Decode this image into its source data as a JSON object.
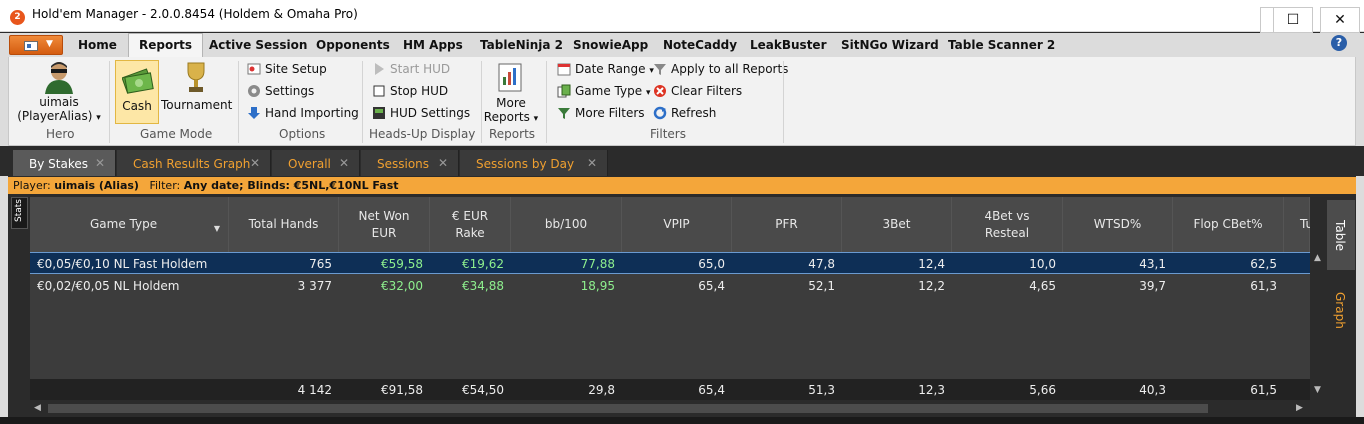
{
  "window": {
    "title": "Hold'em Manager - 2.0.0.8454 (Holdem & Omaha Pro)",
    "app_icon_text": "2",
    "minimize": "—",
    "maximize": "☐",
    "close": "✕"
  },
  "menu_tabs": [
    "Home",
    "Reports",
    "Active Session",
    "Opponents",
    "HM Apps",
    "TableNinja 2",
    "SnowieApp",
    "NoteCaddy",
    "LeakBuster",
    "SitNGo Wizard",
    "Table Scanner 2"
  ],
  "active_menu_tab": "Reports",
  "help_icon": "?",
  "ribbon": {
    "hero": {
      "player_line1": "uimais",
      "player_line2": "(PlayerAlias)",
      "dropdown": "▾",
      "group_label": "Hero"
    },
    "game_mode": {
      "cash_label": "Cash",
      "tournament_label": "Tournament",
      "group_label": "Game Mode"
    },
    "options": {
      "site_setup": "Site Setup",
      "settings": "Settings",
      "hand_importing": "Hand Importing",
      "group_label": "Options"
    },
    "hud": {
      "start_hud": "Start HUD",
      "stop_hud": "Stop HUD",
      "hud_settings": "HUD Settings",
      "group_label": "Heads-Up Display"
    },
    "reports": {
      "more_line1": "More",
      "more_line2": "Reports",
      "dropdown": "▾",
      "group_label": "Reports"
    },
    "filters": {
      "date_range": "Date Range",
      "game_type": "Game Type",
      "more_filters": "More Filters",
      "apply_all": "Apply to all Reports",
      "clear_filters": "Clear Filters",
      "refresh": "Refresh",
      "dropdown": "▾",
      "group_label": "Filters"
    }
  },
  "report_tabs": [
    {
      "label": "By Stakes",
      "active": true
    },
    {
      "label": "Cash Results Graph",
      "active": false
    },
    {
      "label": "Overall",
      "active": false
    },
    {
      "label": "Sessions",
      "active": false
    },
    {
      "label": "Sessions by Day",
      "active": false
    }
  ],
  "tab_close": "✕",
  "filter_bar": {
    "player_label": "Player:",
    "player_value": "uimais (Alias)",
    "filter_label": "Filter:",
    "filter_value": "Any date; Blinds: €5NL,€10NL Fast"
  },
  "stats_tab": "Stats",
  "grid": {
    "headers": [
      {
        "line1": "Game Type",
        "line2": ""
      },
      {
        "line1": "Total Hands",
        "line2": ""
      },
      {
        "line1": "Net Won",
        "line2": "EUR"
      },
      {
        "line1": "€ EUR",
        "line2": "Rake"
      },
      {
        "line1": "bb/100",
        "line2": ""
      },
      {
        "line1": "VPIP",
        "line2": ""
      },
      {
        "line1": "PFR",
        "line2": ""
      },
      {
        "line1": "3Bet",
        "line2": ""
      },
      {
        "line1": "4Bet vs",
        "line2": "Resteal"
      },
      {
        "line1": "WTSD%",
        "line2": ""
      },
      {
        "line1": "Flop CBet%",
        "line2": ""
      },
      {
        "line1": "Tu",
        "line2": ""
      }
    ],
    "sort_caret": "▼",
    "rows": [
      {
        "game": "€0,05/€0,10 NL Fast Holdem",
        "hands": "765",
        "net": "€59,58",
        "rake": "€19,62",
        "bb100": "77,88",
        "vpip": "65,0",
        "pfr": "47,8",
        "threebet": "12,4",
        "fourbet": "10,0",
        "wtsd": "43,1",
        "cbet": "62,5"
      },
      {
        "game": "€0,02/€0,05 NL Holdem",
        "hands": "3 377",
        "net": "€32,00",
        "rake": "€34,88",
        "bb100": "18,95",
        "vpip": "65,4",
        "pfr": "52,1",
        "threebet": "12,2",
        "fourbet": "4,65",
        "wtsd": "39,7",
        "cbet": "61,3"
      }
    ],
    "totals": {
      "hands": "4 142",
      "net": "€91,58",
      "rake": "€54,50",
      "bb100": "29,8",
      "vpip": "65,4",
      "pfr": "51,3",
      "threebet": "12,3",
      "fourbet": "5,66",
      "wtsd": "40,3",
      "cbet": "61,5"
    }
  },
  "side_tabs": {
    "table": "Table",
    "graph": "Graph"
  },
  "scroll": {
    "up": "▲",
    "down": "▼",
    "left": "◀",
    "right": "▶"
  },
  "colors": {
    "accent_orange": "#f4a63a",
    "positive_green": "#8ef08e",
    "selection_blue": "#0e2f56",
    "tab_text_orange": "#f0a030"
  }
}
